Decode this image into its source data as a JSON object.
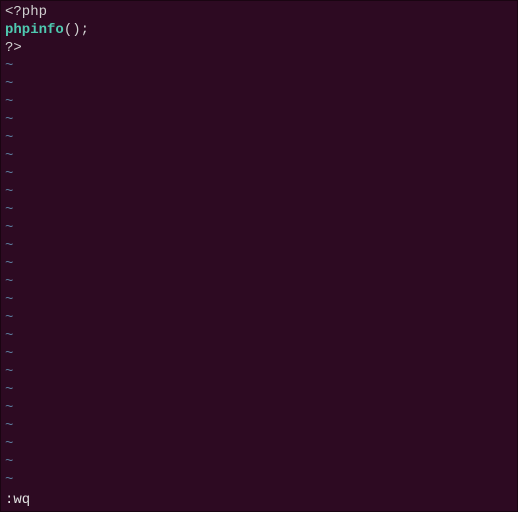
{
  "code": {
    "line1_open": "<?php",
    "line2_func": "phpinfo",
    "line2_paren": "()",
    "line2_semi": ";",
    "line3_close": "?>"
  },
  "tilde": "~",
  "tilde_count": 24,
  "command": ":wq"
}
